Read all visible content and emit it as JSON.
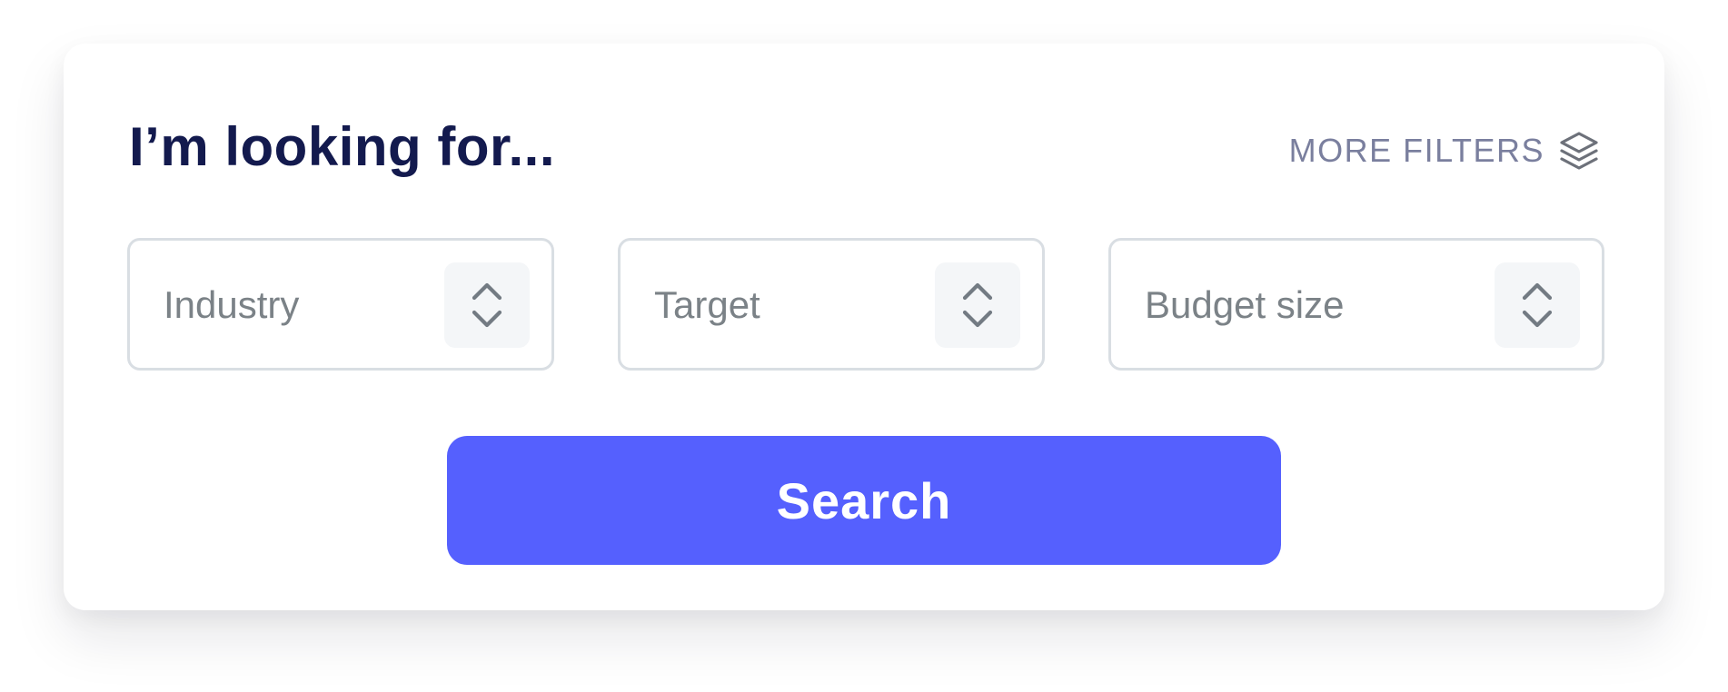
{
  "heading": "I’m looking for...",
  "more_filters": {
    "label": "MORE FILTERS",
    "icon": "layers-icon"
  },
  "filters": [
    {
      "placeholder": "Industry",
      "icon": "chevron-up-down-icon"
    },
    {
      "placeholder": "Target",
      "icon": "chevron-up-down-icon"
    },
    {
      "placeholder": "Budget size",
      "icon": "chevron-up-down-icon"
    }
  ],
  "search_button": {
    "label": "Search"
  },
  "colors": {
    "heading": "#131a4e",
    "accent": "#5560fe",
    "muted_text": "#7b8287",
    "border": "#d9dee3",
    "stepper_bg": "#f4f6f8"
  }
}
